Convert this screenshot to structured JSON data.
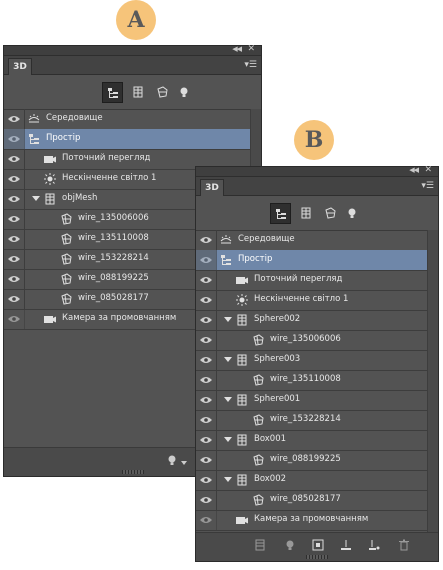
{
  "markers": {
    "a": "A",
    "b": "B"
  },
  "panel_a": {
    "tab_label": "3D",
    "rows": [
      {
        "label": "Середовище",
        "icon": "environment-icon",
        "selected": false
      },
      {
        "label": "Простір",
        "icon": "scene-icon",
        "selected": true
      },
      {
        "label": "Поточний перегляд",
        "icon": "camera-icon",
        "selected": false
      },
      {
        "label": "Нескінченне світло 1",
        "icon": "infinite-light-icon",
        "selected": false
      },
      {
        "label": "objMesh",
        "icon": "mesh-icon",
        "selected": false,
        "expandable": true
      },
      {
        "label": "wire_135006006",
        "icon": "material-icon",
        "selected": false
      },
      {
        "label": "wire_135110008",
        "icon": "material-icon",
        "selected": false
      },
      {
        "label": "wire_153228214",
        "icon": "material-icon",
        "selected": false
      },
      {
        "label": "wire_088199225",
        "icon": "material-icon",
        "selected": false
      },
      {
        "label": "wire_085028177",
        "icon": "material-icon",
        "selected": false
      },
      {
        "label": "Камера за промовчанням",
        "icon": "camera-icon",
        "selected": false
      }
    ]
  },
  "panel_b": {
    "tab_label": "3D",
    "rows": [
      {
        "label": "Середовище",
        "icon": "environment-icon",
        "selected": false
      },
      {
        "label": "Простір",
        "icon": "scene-icon",
        "selected": true
      },
      {
        "label": "Поточний перегляд",
        "icon": "camera-icon",
        "selected": false
      },
      {
        "label": "Нескінченне світло 1",
        "icon": "infinite-light-icon",
        "selected": false
      },
      {
        "label": "Sphere002",
        "icon": "mesh-icon",
        "selected": false,
        "expandable": true
      },
      {
        "label": "wire_135006006",
        "icon": "material-icon",
        "selected": false
      },
      {
        "label": "Sphere003",
        "icon": "mesh-icon",
        "selected": false,
        "expandable": true
      },
      {
        "label": "wire_135110008",
        "icon": "material-icon",
        "selected": false
      },
      {
        "label": "Sphere001",
        "icon": "mesh-icon",
        "selected": false,
        "expandable": true
      },
      {
        "label": "wire_153228214",
        "icon": "material-icon",
        "selected": false
      },
      {
        "label": "Box001",
        "icon": "mesh-icon",
        "selected": false,
        "expandable": true
      },
      {
        "label": "wire_088199225",
        "icon": "material-icon",
        "selected": false
      },
      {
        "label": "Box002",
        "icon": "mesh-icon",
        "selected": false,
        "expandable": true
      },
      {
        "label": "wire_085028177",
        "icon": "material-icon",
        "selected": false
      },
      {
        "label": "Камера за промовчанням",
        "icon": "camera-icon",
        "selected": false
      }
    ]
  },
  "colors": {
    "panel_bg": "#535353",
    "selection": "#6f87a9",
    "marker": "#f6c47a"
  }
}
